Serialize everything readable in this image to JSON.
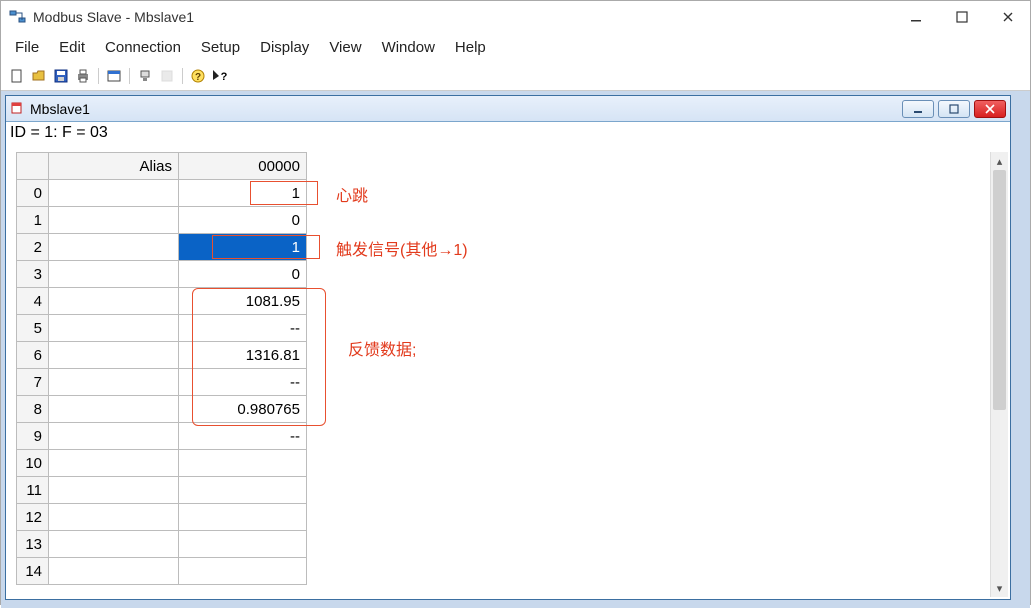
{
  "app": {
    "title": "Modbus Slave - Mbslave1"
  },
  "menu": {
    "file": "File",
    "edit": "Edit",
    "connection": "Connection",
    "setup": "Setup",
    "display": "Display",
    "view": "View",
    "window": "Window",
    "help": "Help"
  },
  "toolbar": {
    "new": "new-icon",
    "open": "open-icon",
    "save": "save-icon",
    "print": "print-icon",
    "window": "window-icon",
    "device": "device-icon",
    "grayed": "grayed-icon",
    "help": "help-icon",
    "context": "context-help-icon"
  },
  "child": {
    "title": "Mbslave1",
    "status_line": "ID = 1: F = 03",
    "headers": {
      "alias": "Alias",
      "col0": "00000"
    },
    "rows": [
      {
        "idx": "0",
        "alias": "",
        "val": "1"
      },
      {
        "idx": "1",
        "alias": "",
        "val": "0"
      },
      {
        "idx": "2",
        "alias": "",
        "val": "1",
        "selected": true
      },
      {
        "idx": "3",
        "alias": "",
        "val": "0"
      },
      {
        "idx": "4",
        "alias": "",
        "val": "1081.95"
      },
      {
        "idx": "5",
        "alias": "",
        "val": "--"
      },
      {
        "idx": "6",
        "alias": "",
        "val": "1316.81"
      },
      {
        "idx": "7",
        "alias": "",
        "val": "--"
      },
      {
        "idx": "8",
        "alias": "",
        "val": "0.980765"
      },
      {
        "idx": "9",
        "alias": "",
        "val": "--"
      },
      {
        "idx": "10",
        "alias": "",
        "val": ""
      },
      {
        "idx": "11",
        "alias": "",
        "val": ""
      },
      {
        "idx": "12",
        "alias": "",
        "val": ""
      },
      {
        "idx": "13",
        "alias": "",
        "val": ""
      },
      {
        "idx": "14",
        "alias": "",
        "val": ""
      }
    ]
  },
  "annotations": {
    "a0": "心跳",
    "a1": "触发信号(其他→1)",
    "a2": "反馈数据;"
  }
}
